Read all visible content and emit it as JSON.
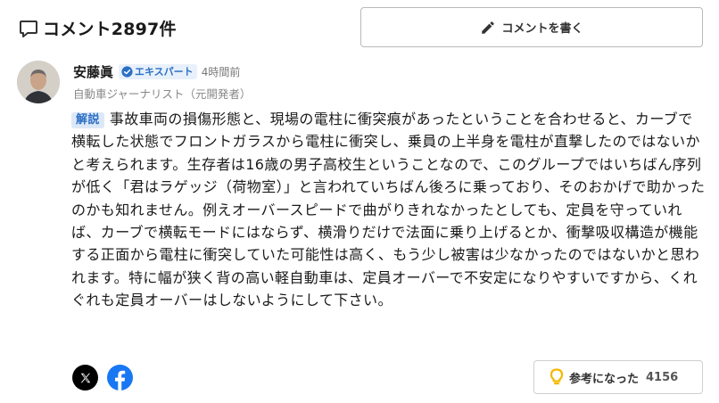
{
  "header": {
    "title": "コメント2897件",
    "write_button_label": "コメントを書く"
  },
  "comment": {
    "author_name": "安藤眞",
    "expert_badge_label": "エキスパート",
    "timestamp": "4時間前",
    "author_title": "自動車ジャーナリスト（元開発者）",
    "label": "解説",
    "body": "事故車両の損傷形態と、現場の電柱に衝突痕があったということを合わせると、カーブで横転した状態でフロントガラスから電柱に衝突し、乗員の上半身を電柱が直撃したのではないかと考えられます。生存者は16歳の男子高校生ということなので、このグループではいちばん序列が低く「君はラゲッジ（荷物室）」と言われていちばん後ろに乗っており、そのおかげで助かったのかも知れません。例えオーバースピードで曲がりきれなかったとしても、定員を守っていれば、カーブで横転モードにはならず、横滑りだけで法面に乗り上げるとか、衝撃吸収構造が機能する正面から電柱に衝突していた可能性は高く、もう少し被害は少なかったのではないかと思われます。特に幅が狭く背の高い軽自動車は、定員オーバーで不安定になりやすいですから、くれぐれも定員オーバーはしないようにして下さい。",
    "helpful_label": "参考になった",
    "helpful_count": "4156"
  },
  "icons": {
    "comment": "speech-bubble-icon",
    "pencil": "pencil-icon",
    "expert": "check-badge-icon",
    "x": "x-logo-icon",
    "facebook": "facebook-logo-icon",
    "helpful": "lightbulb-icon"
  },
  "colors": {
    "accent_blue": "#2b6fc4",
    "badge_bg": "#dde8f7",
    "facebook": "#1877f2",
    "bulb_yellow": "#f5b800"
  }
}
